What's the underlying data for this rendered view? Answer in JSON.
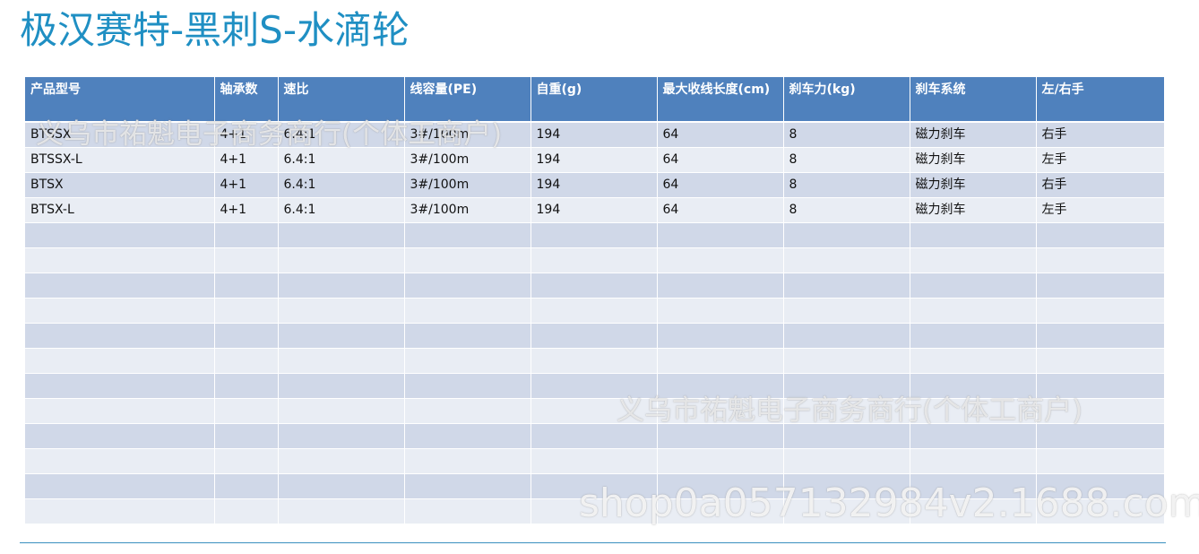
{
  "title": "极汉赛特-黑刺S-水滴轮",
  "table": {
    "headers": [
      "产品型号",
      "轴承数",
      "速比",
      "线容量(PE)",
      "自重(g)",
      "最大收线长度(cm)",
      "刹车力(kg)",
      "刹车系统",
      "左/右手"
    ],
    "rows": [
      [
        "BTSSX",
        "4+1",
        "6.4:1",
        "3#/100m",
        "194",
        "64",
        "8",
        "磁力刹车",
        "右手"
      ],
      [
        "BTSSX-L",
        "4+1",
        "6.4:1",
        "3#/100m",
        "194",
        "64",
        "8",
        "磁力刹车",
        "左手"
      ],
      [
        "BTSX",
        "4+1",
        "6.4:1",
        "3#/100m",
        "194",
        "64",
        "8",
        "磁力刹车",
        "右手"
      ],
      [
        "BTSX-L",
        "4+1",
        "6.4:1",
        "3#/100m",
        "194",
        "64",
        "8",
        "磁力刹车",
        "左手"
      ],
      [
        "",
        "",
        "",
        "",
        "",
        "",
        "",
        "",
        ""
      ],
      [
        "",
        "",
        "",
        "",
        "",
        "",
        "",
        "",
        ""
      ],
      [
        "",
        "",
        "",
        "",
        "",
        "",
        "",
        "",
        ""
      ],
      [
        "",
        "",
        "",
        "",
        "",
        "",
        "",
        "",
        ""
      ],
      [
        "",
        "",
        "",
        "",
        "",
        "",
        "",
        "",
        ""
      ],
      [
        "",
        "",
        "",
        "",
        "",
        "",
        "",
        "",
        ""
      ],
      [
        "",
        "",
        "",
        "",
        "",
        "",
        "",
        "",
        ""
      ],
      [
        "",
        "",
        "",
        "",
        "",
        "",
        "",
        "",
        ""
      ],
      [
        "",
        "",
        "",
        "",
        "",
        "",
        "",
        "",
        ""
      ],
      [
        "",
        "",
        "",
        "",
        "",
        "",
        "",
        "",
        ""
      ],
      [
        "",
        "",
        "",
        "",
        "",
        "",
        "",
        "",
        ""
      ],
      [
        "",
        "",
        "",
        "",
        "",
        "",
        "",
        "",
        ""
      ]
    ]
  },
  "watermarks": {
    "seller_1": "义乌市祐魁电子商务商行(个体工商户)",
    "seller_2": "义乌市祐魁电子商务商行(个体工商户)",
    "shop_url": "shop0a057132984v2.1688.com"
  },
  "colors": {
    "title": "#1f8fc3",
    "header_bg": "#4f81bd",
    "row_odd": "#d0d8e8",
    "row_even": "#e9edf4",
    "rule": "#3a8fbf"
  }
}
